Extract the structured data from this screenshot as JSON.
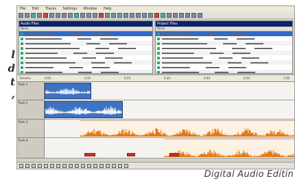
{
  "side_text": [
    "l",
    "d",
    "t",
    ","
  ],
  "app": {
    "menu": [
      "File",
      "Edit",
      "Tracks",
      "Settings",
      "Window",
      "Help"
    ],
    "toolbar_count": 30,
    "left_pane": {
      "title": "Audio Files",
      "rows": 10
    },
    "right_pane": {
      "title": "Project Files",
      "rows": 10
    },
    "timeline_title": "Timeline",
    "ruler": [
      "0:00",
      "0:10",
      "0:20",
      "0:30",
      "0:40",
      "0:50",
      "1:00"
    ],
    "tracks": [
      {
        "name": "Track 1",
        "kind": "blue"
      },
      {
        "name": "Track 2",
        "kind": "blue"
      },
      {
        "name": "Track 3",
        "kind": "orange"
      },
      {
        "name": "Track 4",
        "kind": "orange"
      }
    ],
    "colors": {
      "blue_clip": "#3f73c2",
      "orange_wave": "#e07b1a",
      "selection": "#316ac5"
    }
  },
  "caption": "Digital Audio Editin"
}
